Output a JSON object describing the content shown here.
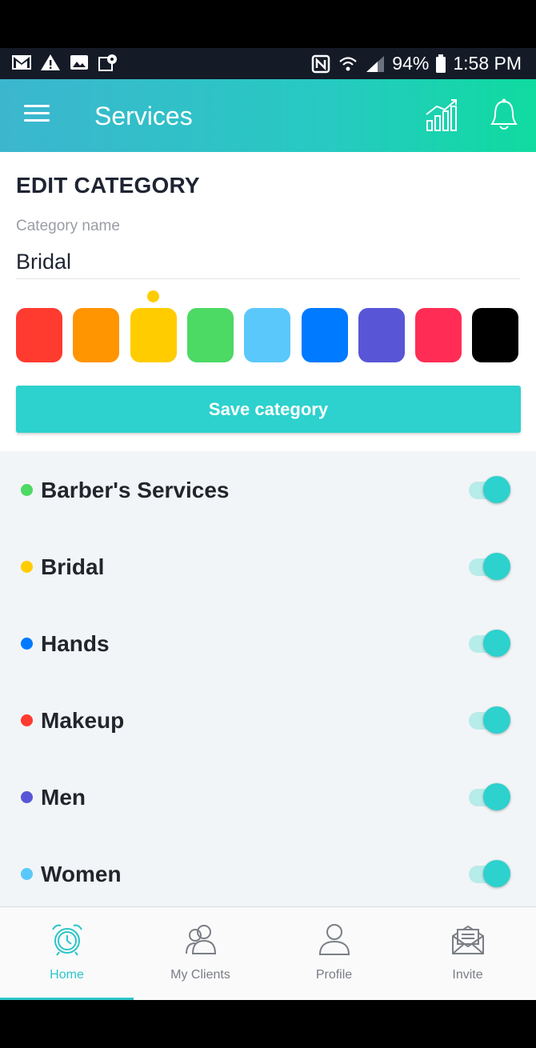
{
  "status_bar": {
    "battery": "94%",
    "time": "1:58 PM"
  },
  "app_bar": {
    "title": "Services",
    "menu_icon": "hamburger-menu-icon",
    "stats_icon": "bar-chart-icon",
    "bell_icon": "bell-icon"
  },
  "edit": {
    "heading": "EDIT CATEGORY",
    "field_label": "Category name",
    "field_value": "Bridal",
    "selected_color_index": 2,
    "colors": [
      "#ff3b30",
      "#ff9500",
      "#ffcc00",
      "#4cd964",
      "#5ac8fa",
      "#007aff",
      "#5856d6",
      "#ff2d55",
      "#000000"
    ],
    "save_label": "Save category"
  },
  "categories": [
    {
      "label": "Barber's Services",
      "color": "#4cd964",
      "enabled": true
    },
    {
      "label": "Bridal",
      "color": "#ffcc00",
      "enabled": true
    },
    {
      "label": "Hands",
      "color": "#007aff",
      "enabled": true
    },
    {
      "label": "Makeup",
      "color": "#ff3b30",
      "enabled": true
    },
    {
      "label": "Men",
      "color": "#5856d6",
      "enabled": true
    },
    {
      "label": "Women",
      "color": "#5ac8fa",
      "enabled": true
    }
  ],
  "nav": {
    "active_index": 0,
    "accent": "#2dc5c9",
    "items": [
      {
        "label": "Home",
        "icon": "alarm-clock-icon"
      },
      {
        "label": "My Clients",
        "icon": "clients-icon"
      },
      {
        "label": "Profile",
        "icon": "profile-icon"
      },
      {
        "label": "Invite",
        "icon": "envelope-icon"
      }
    ]
  }
}
